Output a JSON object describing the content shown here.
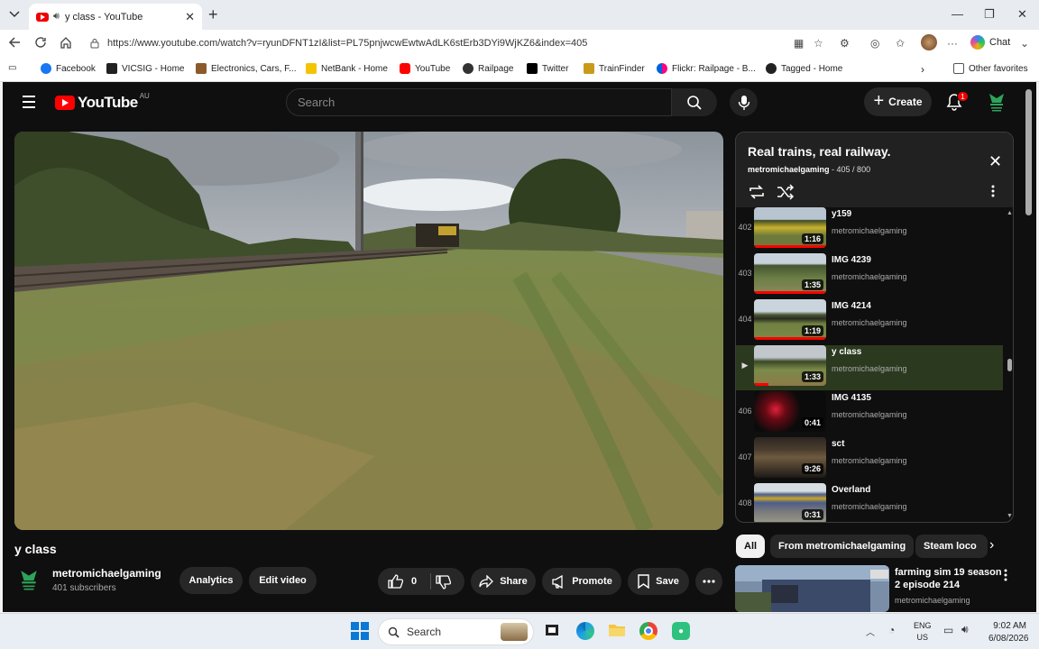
{
  "browser": {
    "tab_title": "y class - YouTube",
    "url": "https://www.youtube.com/watch?v=ryunDFNT1zI&list=PL75pnjwcwEwtwAdLK6stErb3DYi9WjKZ6&index=405",
    "chat_label": "Chat",
    "favorites": [
      {
        "label": "Facebook",
        "color": "#1877f2"
      },
      {
        "label": "VICSIG - Home",
        "color": "#222222"
      },
      {
        "label": "Electronics, Cars, F...",
        "color": "#8b5a2b"
      },
      {
        "label": "NetBank - Home",
        "color": "#f5c400"
      },
      {
        "label": "YouTube",
        "color": "#ff0000"
      },
      {
        "label": "Railpage",
        "color": "#333333"
      },
      {
        "label": "Twitter",
        "color": "#000000"
      },
      {
        "label": "TrainFinder",
        "color": "#c99a1a"
      },
      {
        "label": "Flickr: Railpage - B...",
        "color": "#ff0084"
      },
      {
        "label": "Tagged - Home",
        "color": "#222222"
      }
    ],
    "other_favorites": "Other favorites"
  },
  "youtube": {
    "region": "AU",
    "logo_text": "YouTube",
    "search_placeholder": "Search",
    "create_label": "Create",
    "notification_count": "1",
    "video_title": "y class",
    "channel_name": "metromichaelgaming",
    "subscribers": "401 subscribers",
    "analytics_label": "Analytics",
    "edit_label": "Edit video",
    "like_count": "0",
    "share_label": "Share",
    "promote_label": "Promote",
    "save_label": "Save"
  },
  "playlist": {
    "title": "Real trains, real railway.",
    "owner": "metromichaelgaming",
    "position": "- 405 / 800",
    "items": [
      {
        "num": "402",
        "title": "y159",
        "channel": "metromichaelgaming",
        "duration": "1:16"
      },
      {
        "num": "403",
        "title": "IMG 4239",
        "channel": "metromichaelgaming",
        "duration": "1:35"
      },
      {
        "num": "404",
        "title": "IMG 4214",
        "channel": "metromichaelgaming",
        "duration": "1:19"
      },
      {
        "num": "▶",
        "title": "y class",
        "channel": "metromichaelgaming",
        "duration": "1:33"
      },
      {
        "num": "406",
        "title": "IMG 4135",
        "channel": "metromichaelgaming",
        "duration": "0:41"
      },
      {
        "num": "407",
        "title": "sct",
        "channel": "metromichaelgaming",
        "duration": "9:26"
      },
      {
        "num": "408",
        "title": "Overland",
        "channel": "metromichaelgaming",
        "duration": "0:31"
      }
    ]
  },
  "chips": [
    "All",
    "From metromichaelgaming",
    "Steam loco"
  ],
  "recommendation": {
    "title": "farming sim 19 season 2 episode 214",
    "channel": "metromichaelgaming"
  },
  "taskbar": {
    "search_placeholder": "Search",
    "lang": "ENG",
    "region": "US",
    "time": "9:02 AM",
    "date": "6/08/2026"
  }
}
